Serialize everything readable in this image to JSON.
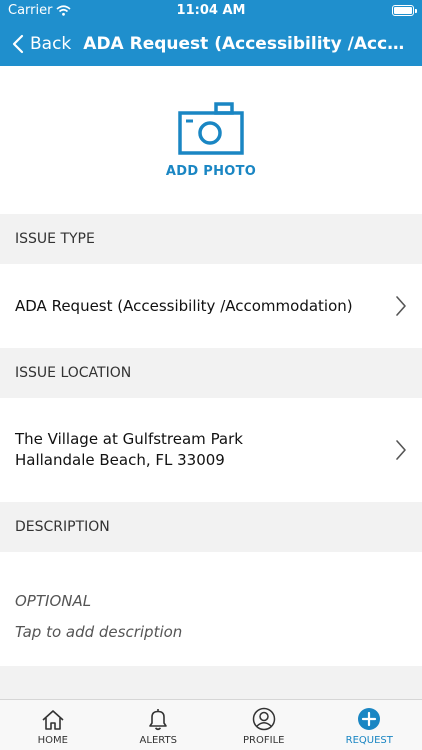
{
  "status_bar": {
    "carrier": "Carrier",
    "time": "11:04 AM"
  },
  "nav": {
    "back_label": "Back",
    "title": "ADA Request (Accessibility /Accommodation)"
  },
  "photo": {
    "label": "ADD PHOTO"
  },
  "issue_type": {
    "header": "ISSUE TYPE",
    "value": "ADA Request (Accessibility /Accommodation)"
  },
  "issue_location": {
    "header": "ISSUE LOCATION",
    "line1": "The Village at Gulfstream Park",
    "line2": "Hallandale Beach, FL 33009"
  },
  "description": {
    "header": "DESCRIPTION",
    "optional": "OPTIONAL",
    "placeholder": "Tap to add description"
  },
  "tabs": [
    {
      "label": "HOME",
      "icon": "home-icon"
    },
    {
      "label": "ALERTS",
      "icon": "bell-icon"
    },
    {
      "label": "PROFILE",
      "icon": "user-icon"
    },
    {
      "label": "REQUEST",
      "icon": "plus-circle-icon",
      "active": true
    }
  ],
  "colors": {
    "primary": "#1f8fcd",
    "accent": "#1a86c3",
    "background": "#f2f2f2"
  }
}
